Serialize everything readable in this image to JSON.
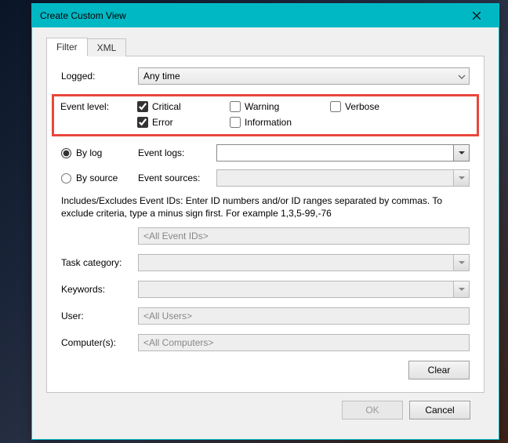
{
  "title": "Create Custom View",
  "tabs": {
    "filter": "Filter",
    "xml": "XML"
  },
  "logged": {
    "label": "Logged:",
    "value": "Any time"
  },
  "eventLevel": {
    "label": "Event level:",
    "critical": "Critical",
    "warning": "Warning",
    "verbose": "Verbose",
    "error": "Error",
    "information": "Information"
  },
  "byLog": {
    "label": "By log",
    "fieldLabel": "Event logs:"
  },
  "bySource": {
    "label": "By source",
    "fieldLabel": "Event sources:"
  },
  "help": "Includes/Excludes Event IDs: Enter ID numbers and/or ID ranges separated by commas. To exclude criteria, type a minus sign first. For example 1,3,5-99,-76",
  "eventIds": {
    "placeholder": "<All Event IDs>"
  },
  "taskCategory": {
    "label": "Task category:"
  },
  "keywords": {
    "label": "Keywords:"
  },
  "user": {
    "label": "User:",
    "placeholder": "<All Users>"
  },
  "computers": {
    "label": "Computer(s):",
    "placeholder": "<All Computers>"
  },
  "buttons": {
    "clear": "Clear",
    "ok": "OK",
    "cancel": "Cancel"
  }
}
